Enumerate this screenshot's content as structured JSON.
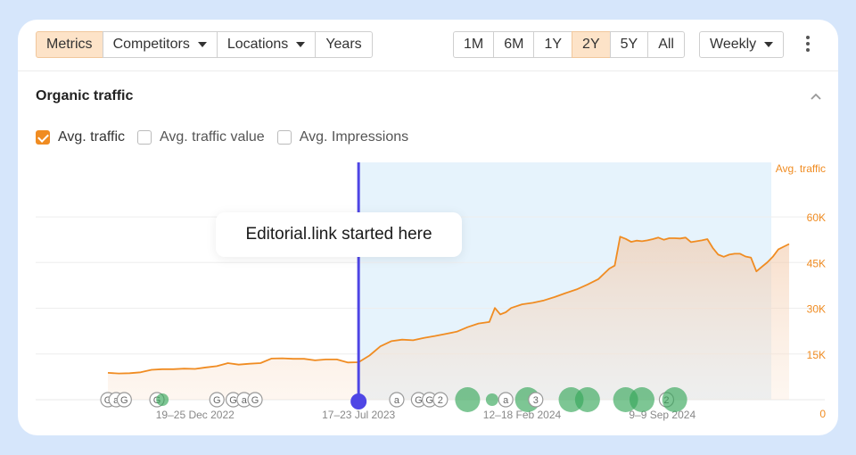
{
  "toolbar": {
    "left_tabs": [
      {
        "label": "Metrics",
        "active": true,
        "dropdown": false
      },
      {
        "label": "Competitors",
        "active": false,
        "dropdown": true
      },
      {
        "label": "Locations",
        "active": false,
        "dropdown": true
      },
      {
        "label": "Years",
        "active": false,
        "dropdown": false
      }
    ],
    "ranges": [
      {
        "label": "1M",
        "active": false
      },
      {
        "label": "6M",
        "active": false
      },
      {
        "label": "1Y",
        "active": false
      },
      {
        "label": "2Y",
        "active": true
      },
      {
        "label": "5Y",
        "active": false
      },
      {
        "label": "All",
        "active": false
      }
    ],
    "granularity": "Weekly",
    "more_icon": "kebab-menu-icon"
  },
  "section": {
    "title": "Organic traffic",
    "collapse_icon": "chevron-up-icon"
  },
  "metrics": [
    {
      "label": "Avg. traffic",
      "checked": true
    },
    {
      "label": "Avg. traffic value",
      "checked": false
    },
    {
      "label": "Avg. Impressions",
      "checked": false
    }
  ],
  "callout": "Editorial.link started here",
  "colors": {
    "accent": "#f08c22",
    "active_bg": "#fde3c8",
    "marker_line": "#4f46e5",
    "highlight_band": "#e6f3fc",
    "update_bubble": "#38a85a"
  },
  "chart_data": {
    "type": "area",
    "ylabel": "Avg. traffic",
    "ylim": [
      0,
      65000
    ],
    "y_ticks": [
      "0",
      "15K",
      "30K",
      "45K",
      "60K"
    ],
    "x_tick_labels": [
      "19–25 Dec 2022",
      "17–23 Jul 2023",
      "12–18 Feb 2024",
      "9–9 Sep 2024"
    ],
    "x_range_weeks": [
      -16,
      89
    ],
    "x_tick_weeks": [
      0,
      30,
      60,
      89
    ],
    "marker_week": 30,
    "series": [
      {
        "values": [
          [
            -16,
            8800
          ],
          [
            -14,
            8600
          ],
          [
            -12,
            8700
          ],
          [
            -10,
            9000
          ],
          [
            -8,
            9800
          ],
          [
            -6,
            10000
          ],
          [
            -4,
            10000
          ],
          [
            -2,
            10200
          ],
          [
            0,
            10100
          ],
          [
            2,
            10600
          ],
          [
            4,
            11000
          ],
          [
            6,
            12000
          ],
          [
            8,
            11500
          ],
          [
            10,
            11800
          ],
          [
            12,
            12000
          ],
          [
            14,
            13500
          ],
          [
            16,
            13600
          ],
          [
            18,
            13400
          ],
          [
            20,
            13400
          ],
          [
            22,
            12900
          ],
          [
            24,
            13200
          ],
          [
            26,
            13200
          ],
          [
            28,
            12200
          ],
          [
            30,
            12300
          ],
          [
            32,
            14500
          ],
          [
            34,
            17500
          ],
          [
            36,
            19200
          ],
          [
            38,
            19700
          ],
          [
            40,
            19500
          ],
          [
            42,
            20300
          ],
          [
            44,
            20900
          ],
          [
            46,
            21600
          ],
          [
            48,
            22300
          ],
          [
            50,
            23800
          ],
          [
            52,
            25000
          ],
          [
            54,
            25500
          ],
          [
            55,
            30100
          ],
          [
            56,
            28000
          ],
          [
            57,
            28700
          ],
          [
            58,
            30100
          ],
          [
            60,
            31300
          ],
          [
            62,
            31800
          ],
          [
            64,
            32600
          ],
          [
            66,
            33700
          ],
          [
            68,
            35000
          ],
          [
            70,
            36200
          ],
          [
            72,
            37800
          ],
          [
            74,
            39600
          ],
          [
            76,
            43000
          ],
          [
            77,
            44000
          ],
          [
            78,
            53500
          ],
          [
            79,
            52800
          ],
          [
            80,
            51800
          ],
          [
            81,
            52200
          ],
          [
            82,
            52000
          ],
          [
            83,
            52300
          ],
          [
            84,
            52700
          ],
          [
            85,
            53200
          ],
          [
            86,
            52500
          ],
          [
            87,
            53000
          ],
          [
            88,
            53000
          ],
          [
            89,
            52900
          ],
          [
            90,
            53200
          ],
          [
            91,
            51700
          ],
          [
            92,
            52000
          ],
          [
            93,
            52300
          ],
          [
            94,
            52700
          ],
          [
            95,
            49800
          ],
          [
            96,
            47600
          ],
          [
            97,
            46900
          ],
          [
            98,
            47600
          ],
          [
            99,
            47900
          ],
          [
            100,
            47900
          ],
          [
            101,
            47000
          ],
          [
            102,
            46600
          ],
          [
            103,
            42100
          ],
          [
            104,
            43600
          ],
          [
            105,
            45100
          ],
          [
            106,
            46900
          ],
          [
            107,
            49300
          ],
          [
            108,
            50200
          ],
          [
            109,
            51100
          ]
        ]
      }
    ]
  },
  "update_markers": [
    {
      "week": -16,
      "label": "G",
      "type": "outline"
    },
    {
      "week": -14.5,
      "label": "a",
      "type": "outline"
    },
    {
      "week": -13,
      "label": "G",
      "type": "outline"
    },
    {
      "week": -7,
      "label": "G",
      "type": "outline"
    },
    {
      "week": -6,
      "label": "",
      "type": "bubble-small"
    },
    {
      "week": 4,
      "label": "G",
      "type": "outline"
    },
    {
      "week": 7,
      "label": "G",
      "type": "outline"
    },
    {
      "week": 9,
      "label": "a",
      "type": "outline"
    },
    {
      "week": 11,
      "label": "G",
      "type": "outline"
    },
    {
      "week": 37,
      "label": "a",
      "type": "outline"
    },
    {
      "week": 41,
      "label": "G",
      "type": "outline"
    },
    {
      "week": 43,
      "label": "G",
      "type": "outline"
    },
    {
      "week": 45,
      "label": "2",
      "type": "outline"
    },
    {
      "week": 50,
      "label": "",
      "type": "bubble"
    },
    {
      "week": 54.5,
      "label": "",
      "type": "bubble-small"
    },
    {
      "week": 57,
      "label": "a",
      "type": "outline"
    },
    {
      "week": 61,
      "label": "",
      "type": "bubble"
    },
    {
      "week": 62.5,
      "label": "3",
      "type": "outline"
    },
    {
      "week": 69,
      "label": "",
      "type": "bubble"
    },
    {
      "week": 72,
      "label": "",
      "type": "bubble"
    },
    {
      "week": 79,
      "label": "",
      "type": "bubble"
    },
    {
      "week": 82,
      "label": "",
      "type": "bubble"
    },
    {
      "week": 86.5,
      "label": "2",
      "type": "outline"
    },
    {
      "week": 88,
      "label": "",
      "type": "bubble"
    }
  ]
}
